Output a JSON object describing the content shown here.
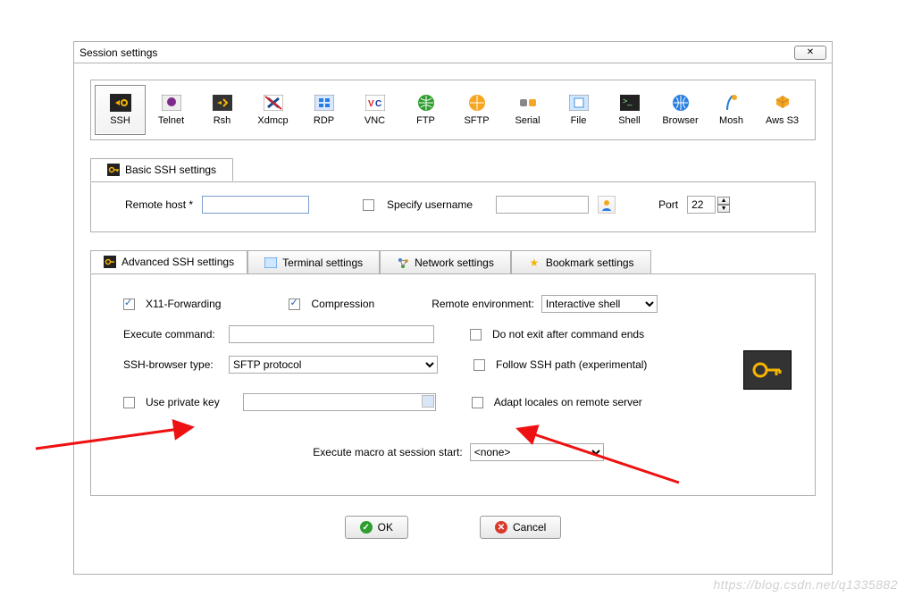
{
  "dialog": {
    "title": "Session settings"
  },
  "protocols": {
    "items": [
      {
        "label": "SSH"
      },
      {
        "label": "Telnet"
      },
      {
        "label": "Rsh"
      },
      {
        "label": "Xdmcp"
      },
      {
        "label": "RDP"
      },
      {
        "label": "VNC"
      },
      {
        "label": "FTP"
      },
      {
        "label": "SFTP"
      },
      {
        "label": "Serial"
      },
      {
        "label": "File"
      },
      {
        "label": "Shell"
      },
      {
        "label": "Browser"
      },
      {
        "label": "Mosh"
      },
      {
        "label": "Aws S3"
      }
    ]
  },
  "basic": {
    "tab_label": "Basic SSH settings",
    "remote_host_label": "Remote host *",
    "specify_username_label": "Specify username",
    "port_label": "Port",
    "port_value": "22"
  },
  "adv_tabs": {
    "t0": "Advanced SSH settings",
    "t1": "Terminal settings",
    "t2": "Network settings",
    "t3": "Bookmark settings"
  },
  "adv": {
    "x11": "X11-Forwarding",
    "compression": "Compression",
    "remote_env_label": "Remote environment:",
    "remote_env_value": "Interactive shell",
    "exec_cmd_label": "Execute command:",
    "do_not_exit": "Do not exit after command ends",
    "ssh_browser_label": "SSH-browser type:",
    "ssh_browser_value": "SFTP protocol",
    "follow_ssh_path": "Follow SSH path (experimental)",
    "use_private_key": "Use private key",
    "adapt_locales": "Adapt locales on remote server",
    "exec_macro_label": "Execute macro at session start:",
    "exec_macro_value": "<none>"
  },
  "buttons": {
    "ok": "OK",
    "cancel": "Cancel"
  },
  "watermark": "https://blog.csdn.net/q1335882"
}
